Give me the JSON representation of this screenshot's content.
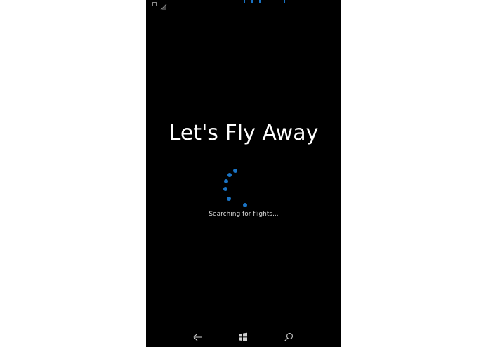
{
  "app": {
    "title": "Let's Fly Away",
    "status_message": "Searching for flights..."
  },
  "colors": {
    "background": "#000000",
    "accent": "#1a73c4",
    "text": "#ffffff"
  },
  "status_bar": {
    "icons": [
      "notification-icon",
      "no-signal-icon"
    ]
  },
  "nav_bar": {
    "buttons": [
      {
        "name": "back-button",
        "icon": "back-arrow-icon"
      },
      {
        "name": "start-button",
        "icon": "windows-logo-icon"
      },
      {
        "name": "search-button",
        "icon": "search-icon"
      }
    ]
  }
}
